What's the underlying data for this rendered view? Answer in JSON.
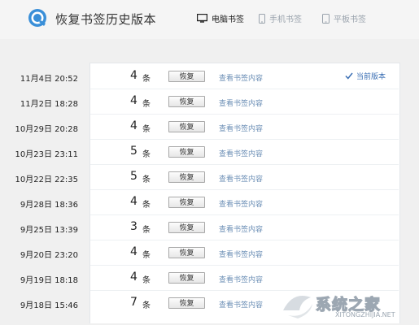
{
  "header": {
    "title": "恢复书签历史版本",
    "tabs": [
      {
        "label": "电脑书签",
        "icon": "monitor-icon",
        "active": true
      },
      {
        "label": "手机书签",
        "icon": "phone-icon",
        "active": false
      },
      {
        "label": "平板书签",
        "icon": "tablet-icon",
        "active": false
      }
    ]
  },
  "versions": {
    "restore_label": "恢复",
    "view_label": "查看书签内容",
    "unit": "条",
    "current_label": "当前版本",
    "rows": [
      {
        "date": "11月4日 20:52",
        "count": "4",
        "current": true
      },
      {
        "date": "11月2日 18:28",
        "count": "4"
      },
      {
        "date": "10月29日 20:28",
        "count": "4"
      },
      {
        "date": "10月23日 23:11",
        "count": "5"
      },
      {
        "date": "10月22日 22:35",
        "count": "5"
      },
      {
        "date": "9月28日 18:36",
        "count": "4"
      },
      {
        "date": "9月25日 13:39",
        "count": "3"
      },
      {
        "date": "9月20日 23:20",
        "count": "4"
      },
      {
        "date": "9月19日 18:18",
        "count": "4"
      },
      {
        "date": "9月18日 15:46",
        "count": "7"
      }
    ]
  },
  "watermark": {
    "text": "系统之家",
    "sub": "XITONGZHIJIA.NET"
  },
  "colors": {
    "accent": "#3b6fb4",
    "link": "#6c8fb6",
    "background": "#f0f0f0"
  }
}
